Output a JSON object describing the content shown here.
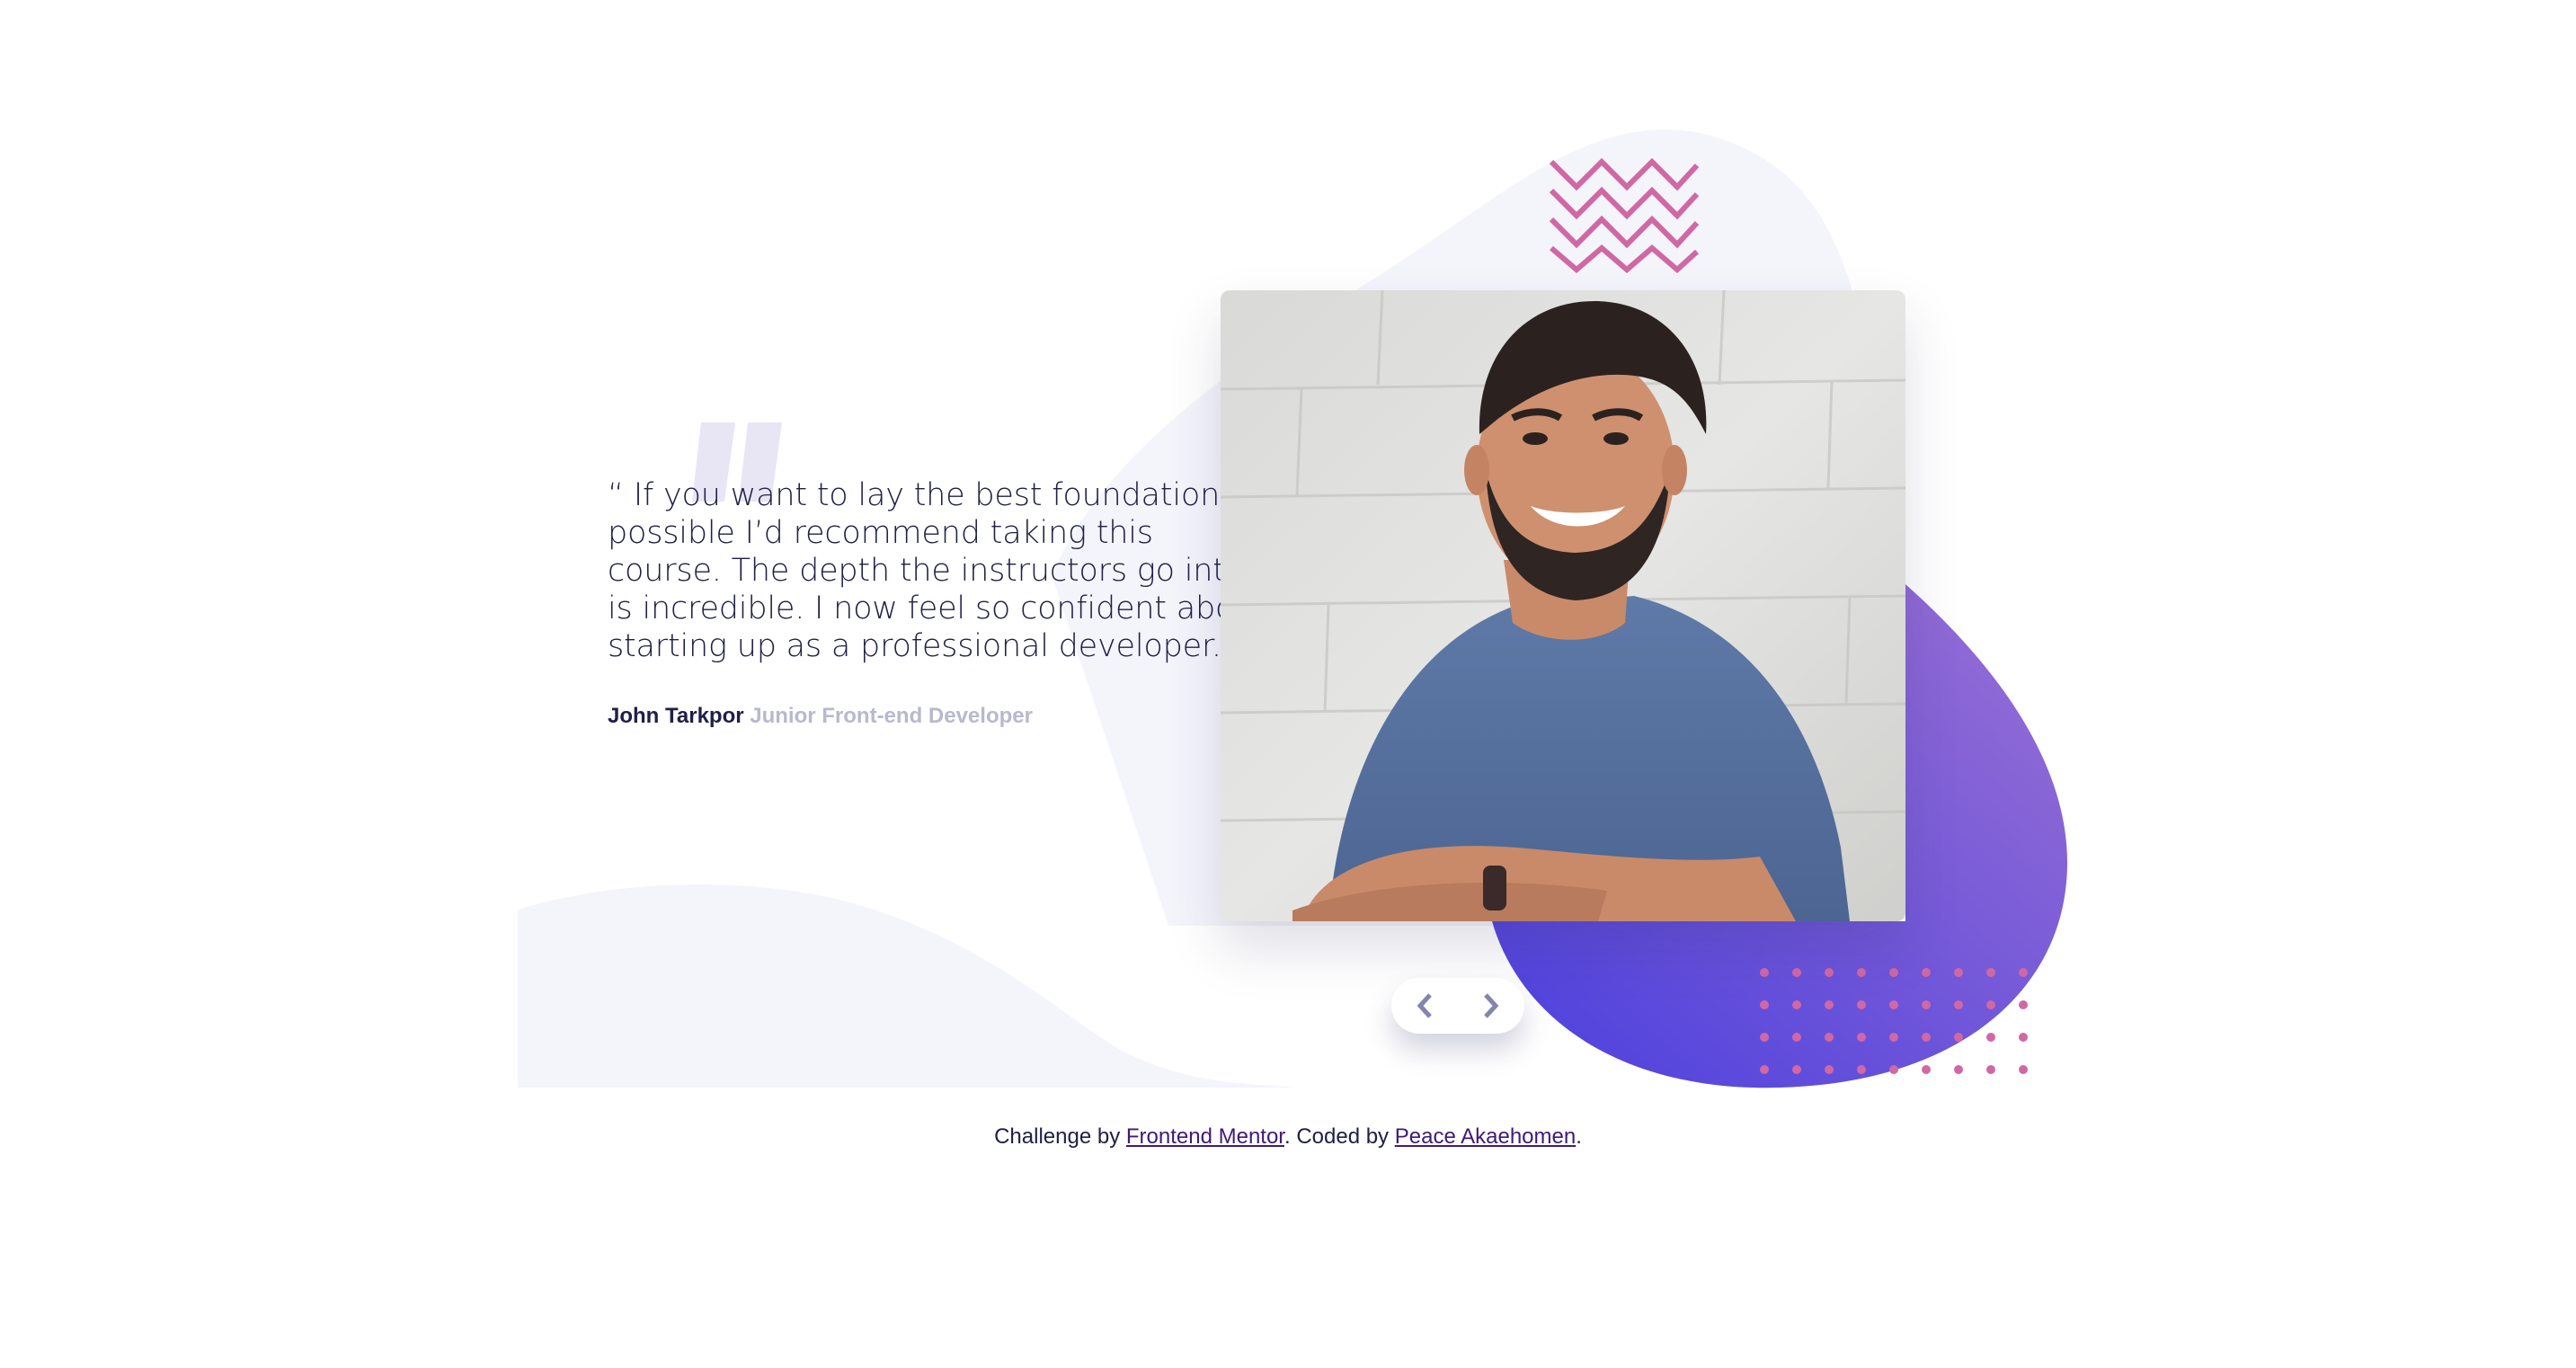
{
  "testimonial": {
    "quote": "“ If you want to lay the best foundation possible I’d recommend taking this course. The depth the instructors go into is incredible. I now feel so confident about starting up as a professional developer. ”",
    "author_name": "John Tarkpor",
    "author_role": "Junior Front-end Developer"
  },
  "navigation": {
    "prev_icon": "chevron-left-icon",
    "next_icon": "chevron-right-icon"
  },
  "attribution": {
    "prefix": "Challenge by",
    "challenge_link": "Frontend Mentor",
    "middle": ". Coded by",
    "author_link": "Peace Akaehomen",
    "suffix": "."
  },
  "colors": {
    "dark_blue": "#202046",
    "grayish_blue": "#b8b8cf",
    "light_background": "#f4f4fb",
    "gradient_start": "#4a3fde",
    "gradient_end": "#9a70d4",
    "accent_pink": "#d068a4",
    "link": "#3e1a7a"
  }
}
